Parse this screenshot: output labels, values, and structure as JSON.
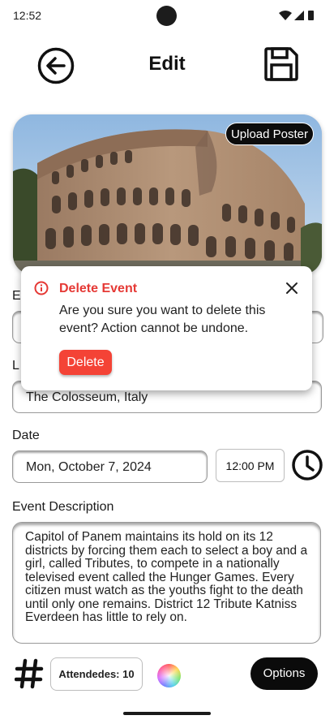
{
  "status_bar": {
    "time": "12:52",
    "icons": [
      "wifi-icon",
      "signal-icon",
      "battery-icon"
    ]
  },
  "header": {
    "title": "Edit",
    "back_icon": "back-arrow-icon",
    "save_icon": "save-icon"
  },
  "poster": {
    "upload_label": "Upload Poster",
    "image_subject": "colosseum-photo"
  },
  "form": {
    "name_label": "E",
    "location_label": "L",
    "location_value": "The Colosseum, Italy",
    "date_label": "Date",
    "date_value": "Mon, October 7, 2024",
    "time_value": "12:00 PM",
    "description_label": "Event Description",
    "description_value": "Capitol of Panem maintains its hold on its 12 districts by forcing them each to select a boy and a girl, called Tributes, to compete in a nationally televised event called the Hunger Games. Every citizen must watch as the youths fight to the death until only one remains. District 12 Tribute Katniss Everdeen has little to rely on."
  },
  "bottom_bar": {
    "hashtag_icon": "hashtag-icon",
    "attendees_label": "Attendedes: 10",
    "color_icon": "color-wheel-icon",
    "options_label": "Options"
  },
  "dialog": {
    "title": "Delete Event",
    "message": "Are you sure you want to delete this event? Action cannot be undone.",
    "delete_label": "Delete",
    "title_color": "#e53935",
    "button_color": "#f44336"
  }
}
